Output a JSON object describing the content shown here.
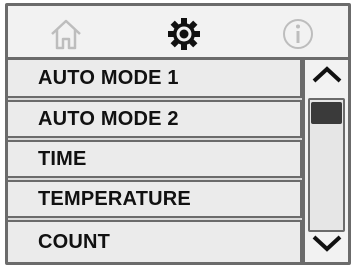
{
  "topbar": {
    "icons": [
      "home-icon",
      "gear-icon",
      "info-icon"
    ]
  },
  "menu": {
    "items": [
      {
        "label": "AUTO MODE 1"
      },
      {
        "label": "AUTO MODE 2"
      },
      {
        "label": "TIME"
      },
      {
        "label": "TEMPERATURE"
      },
      {
        "label": "COUNT"
      }
    ]
  },
  "scrollbar": {
    "up_icon": "arrow-up-icon",
    "down_icon": "arrow-down-icon",
    "position": 0
  },
  "colors": {
    "border": "#6b6b6b",
    "background": "#d9d9d9",
    "item": "#ebebeb",
    "thumb": "#3a3a3a",
    "inactive_icon": "#bdbdbd",
    "active_icon": "#111111"
  }
}
